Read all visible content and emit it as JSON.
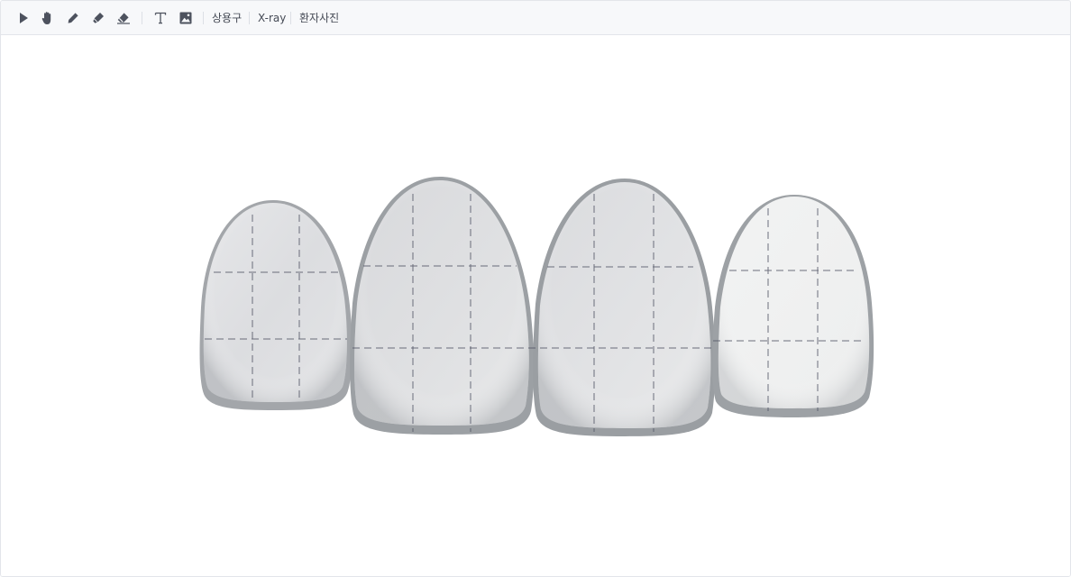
{
  "toolbar": {
    "tools": [
      {
        "name": "select-tool",
        "icon": "cursor-arrow-icon"
      },
      {
        "name": "pan-tool",
        "icon": "hand-icon"
      },
      {
        "name": "pen-tool",
        "icon": "pen-icon"
      },
      {
        "name": "marker-tool",
        "icon": "marker-icon"
      },
      {
        "name": "eraser-tool",
        "icon": "eraser-icon"
      },
      {
        "name": "text-tool",
        "icon": "text-icon"
      },
      {
        "name": "image-tool",
        "icon": "image-icon"
      }
    ],
    "menu": {
      "phrases_label": "상용구",
      "xray_label": "X-ray",
      "patient_photo_label": "환자사진"
    }
  },
  "canvas": {
    "content": "four-anterior-teeth-outline-with-dashed-guide-grid",
    "colors": {
      "tooth_light": "#f0f1f2",
      "tooth_mid": "#dedfe1",
      "tooth_shadow": "#9a9ea2",
      "guide_line": "#555868"
    }
  }
}
